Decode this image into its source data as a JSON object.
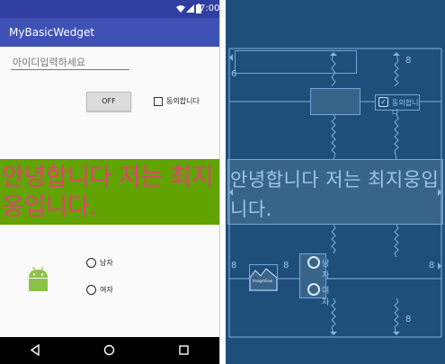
{
  "status_bar": {
    "time": "7:00"
  },
  "app_bar": {
    "title": "MyBasicWedget"
  },
  "form": {
    "id_placeholder": "아이디입력하세요",
    "toggle_label": "OFF",
    "agree_label": "동의합니다"
  },
  "banner": {
    "text": "안녕합니다 저는 최지웅입니다."
  },
  "radios": {
    "male": "남자",
    "female": "여자"
  },
  "blueprint": {
    "margin_label": "8",
    "left_margin_label": "6",
    "checkbox_label": "동의합니다",
    "banner_text": "안녕합니다 저는 최지웅입니다.",
    "imageview_label": "ImageView",
    "radio_male": "남자",
    "radio_female": "여자"
  },
  "colors": {
    "primary": "#3f51b5",
    "primary_dark": "#303f9f",
    "banner_bg": "#61a300",
    "banner_text": "#e6407a",
    "blueprint_bg": "#1e4f7a",
    "blueprint_line": "#6fa6d9"
  }
}
